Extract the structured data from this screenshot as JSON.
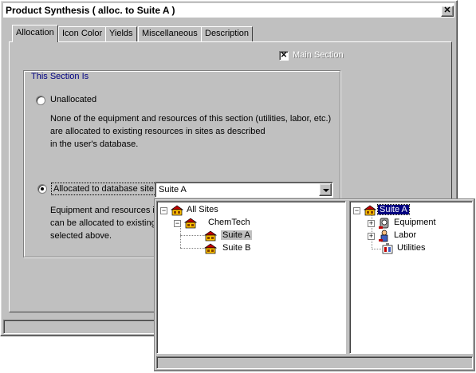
{
  "window": {
    "title": "Product Synthesis (  alloc. to Suite A )",
    "close_glyph": "✕"
  },
  "tabs": [
    {
      "label": "Allocation",
      "active": true
    },
    {
      "label": "Icon Color",
      "active": false
    },
    {
      "label": "Yields",
      "active": false
    },
    {
      "label": "Miscellaneous",
      "active": false
    },
    {
      "label": "Description",
      "active": false
    }
  ],
  "main_section": {
    "label": "Main Section",
    "checked": true,
    "check_glyph": "✕",
    "enabled": false
  },
  "section_group": {
    "legend": "This Section Is",
    "unallocated": {
      "label": "Unallocated",
      "selected": false,
      "description": [
        "None of the equipment and resources of this section (utilities, labor, etc.)",
        "are allocated to existing resources in sites as described",
        "in the user's database."
      ]
    },
    "allocated": {
      "label": "Allocated to database site",
      "selected": true,
      "description": [
        "Equipment and resources in",
        "can be allocated to existing",
        "selected above."
      ]
    },
    "site_combo": {
      "value": "Suite A"
    }
  },
  "site_tree": {
    "nodes": [
      {
        "label": "All Sites",
        "level": 0,
        "expander": "−",
        "icon": "site-icon"
      },
      {
        "label": "ChemTech",
        "level": 1,
        "expander": "−",
        "icon": "site-icon"
      },
      {
        "label": "Suite A",
        "level": 2,
        "icon": "site-icon",
        "highlighted": true
      },
      {
        "label": "Suite B",
        "level": 2,
        "icon": "site-icon"
      }
    ]
  },
  "resource_tree": {
    "nodes": [
      {
        "label": "Suite A",
        "level": 0,
        "expander": "−",
        "icon": "site-icon",
        "selected": true
      },
      {
        "label": "Equipment",
        "level": 1,
        "expander": "+",
        "icon": "equipment-icon"
      },
      {
        "label": "Labor",
        "level": 1,
        "expander": "+",
        "icon": "labor-icon"
      },
      {
        "label": "Utilities",
        "level": 1,
        "icon": "utilities-icon"
      }
    ]
  },
  "colors": {
    "dialog_face": "#c0c0c0",
    "selection": "#000080",
    "group_legend": "#000080",
    "icon_roof": "#c00000",
    "icon_wall": "#ffc000"
  }
}
